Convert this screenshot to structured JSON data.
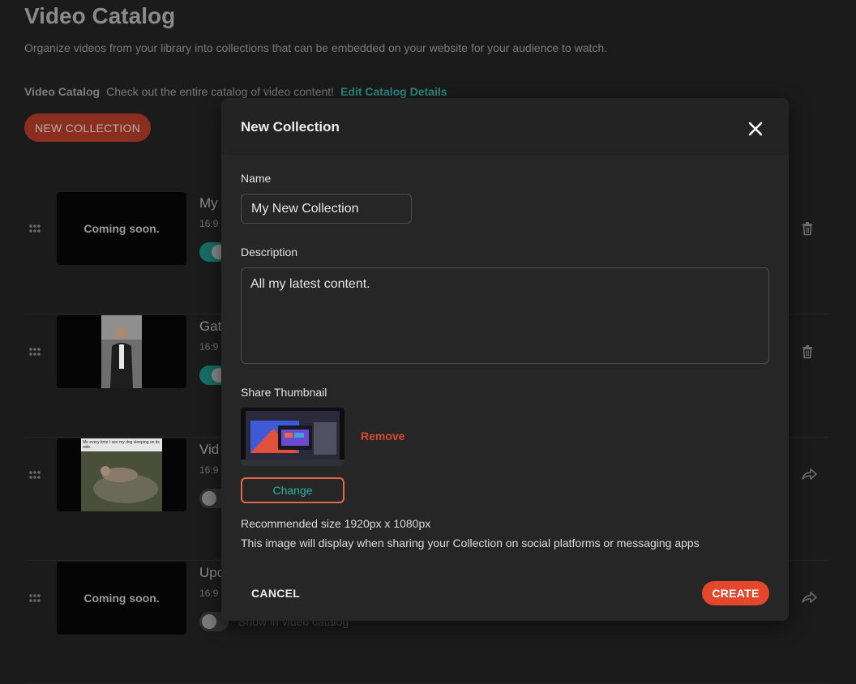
{
  "page": {
    "title": "Video Catalog",
    "subtitle": "Organize videos from your library into collections that can be embedded on your website for your audience to watch.",
    "catalog_label": "Video Catalog",
    "catalog_desc": "Check out the entire catalog of video content!",
    "edit_link": "Edit Catalog Details",
    "new_collection_label": "NEW COLLECTION"
  },
  "rows": [
    {
      "title": "My",
      "meta": "16:9",
      "thumb_text": "Coming soon.",
      "toggle_on": true,
      "icon": "trash-icon"
    },
    {
      "title": "Gat",
      "meta": "16:9",
      "thumb_text": "",
      "toggle_on": true,
      "icon": "trash-icon"
    },
    {
      "title": "Vid",
      "meta": "16:9",
      "thumb_text": "",
      "thumb_caption": "Me every time I see my dog sleeping on its side.",
      "toggle_on": false,
      "icon": "share-icon"
    },
    {
      "title": "Upc",
      "meta": "16:9",
      "thumb_text": "Coming soon.",
      "toggle_on": false,
      "toggle_label": "Show in video catalog",
      "icon": "share-icon"
    }
  ],
  "modal": {
    "title": "New Collection",
    "name_label": "Name",
    "name_value": "My New Collection",
    "description_label": "Description",
    "description_value": "All my latest content.",
    "thumbnail_label": "Share Thumbnail",
    "remove_label": "Remove",
    "change_label": "Change",
    "hint_size": "Recommended size 1920px x 1080px",
    "hint_usage": "This image will display when sharing your Collection on social platforms or messaging apps",
    "cancel_label": "CANCEL",
    "create_label": "CREATE"
  },
  "colors": {
    "accent_teal": "#2bb5a8",
    "accent_red": "#e5472d",
    "modal_bg": "#262626"
  }
}
